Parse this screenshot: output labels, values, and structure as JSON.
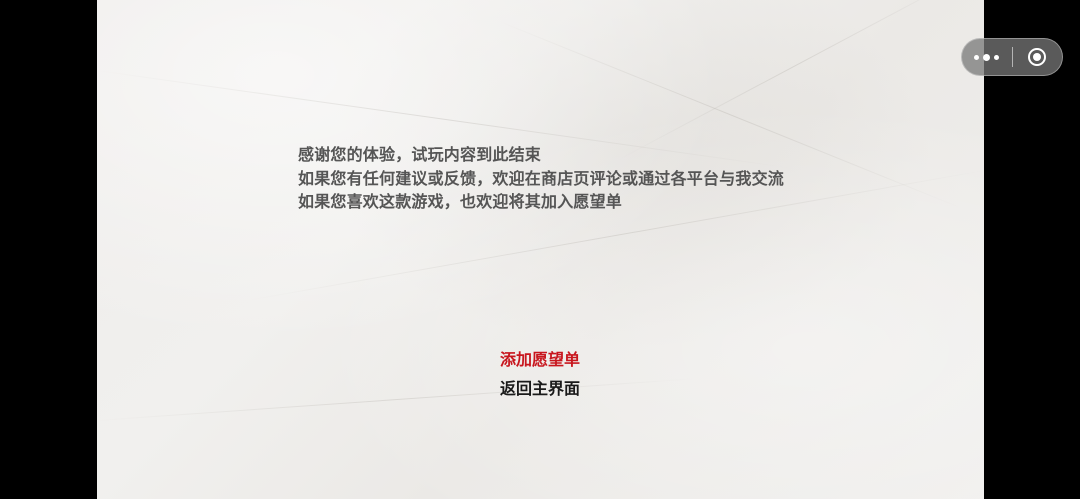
{
  "message": {
    "lines": [
      "感谢您的体验，试玩内容到此结束",
      "如果您有任何建议或反馈，欢迎在商店页评论或通过各平台与我交流",
      "如果您喜欢这款游戏，也欢迎将其加入愿望单"
    ]
  },
  "menu": {
    "items": [
      {
        "label": "添加愿望单",
        "color": "#c8161e"
      },
      {
        "label": "返回主界面",
        "color": "#1a1a1a"
      }
    ]
  },
  "capsule": {
    "more_icon": "more-dots-icon",
    "close_icon": "record-circle-icon"
  },
  "colors": {
    "background": "#000000",
    "paper": "#efeeec",
    "message_text": "#555555",
    "accent": "#c8161e"
  }
}
